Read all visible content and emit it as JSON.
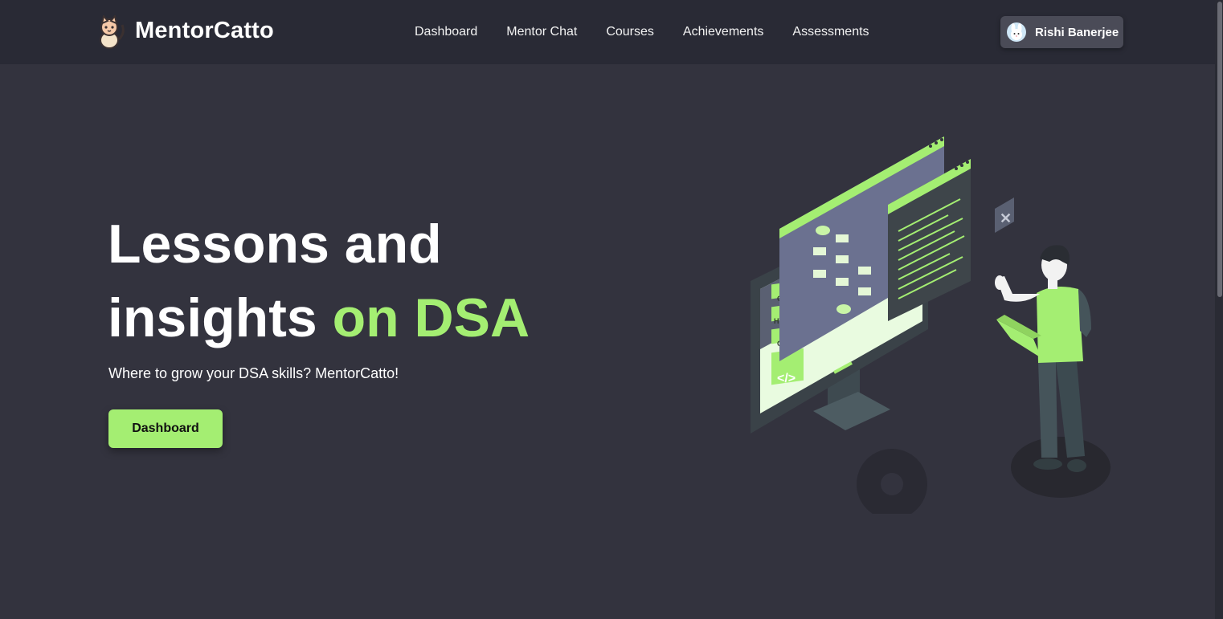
{
  "header": {
    "brand": "MentorCatto",
    "nav": [
      "Dashboard",
      "Mentor Chat",
      "Courses",
      "Achievements",
      "Assessments"
    ],
    "user": {
      "name": "Rishi Banerjee"
    }
  },
  "hero": {
    "title_line1": "Lessons and",
    "title_line2_prefix": "insights ",
    "title_line2_accent": "on DSA",
    "subtitle": "Where to grow your DSA skills? MentorCatto!",
    "cta_label": "Dashboard"
  },
  "illustration": {
    "tags": [
      "CSS",
      "HTML",
      "C++"
    ],
    "code_symbol": "</>",
    "colors": {
      "accent": "#a4ee72",
      "screen": "#5a5f7a",
      "dark": "#292a35"
    }
  },
  "theme": {
    "background": "#33333e",
    "navbar": "#292a35",
    "accent": "#a4ee72"
  }
}
